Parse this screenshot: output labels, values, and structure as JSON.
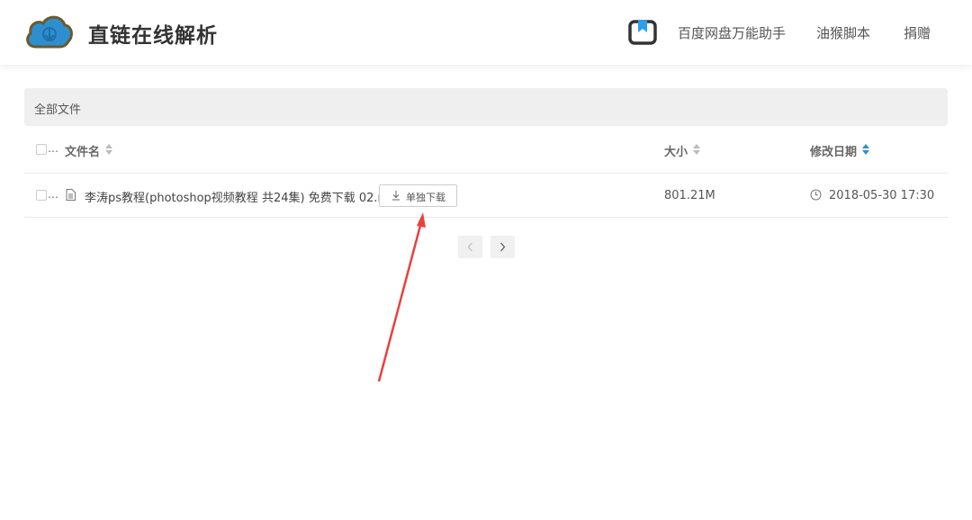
{
  "header": {
    "site_title": "直链在线解析",
    "nav": [
      "百度网盘万能助手",
      "油猴脚本",
      "捐赠"
    ]
  },
  "breadcrumb": {
    "label": "全部文件"
  },
  "table": {
    "columns": {
      "name": "文件名",
      "size": "大小",
      "modified": "修改日期"
    },
    "ellipsis": "…",
    "rows": [
      {
        "name": "李涛ps教程(photoshop视频教程 共24集) 免费下载 02.rar",
        "download_label": "单独下载",
        "size": "801.21M",
        "modified": "2018-05-30 17:30"
      }
    ]
  },
  "colors": {
    "logo_blue": "#2d8fd0",
    "sort_active": "#2d8fd0",
    "annotation_red": "#e8413d"
  },
  "icons": [
    "cloud-download-icon",
    "bookmark-icon",
    "file-icon",
    "download-icon",
    "clock-icon",
    "chevron-left-icon",
    "chevron-right-icon",
    "sort-icon"
  ]
}
